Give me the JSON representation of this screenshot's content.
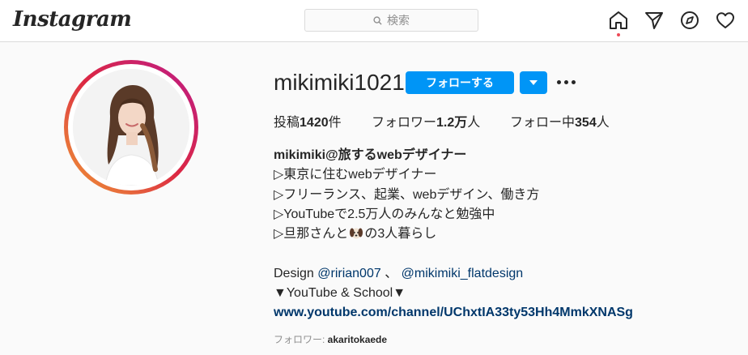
{
  "header": {
    "logo_text": "Instagram",
    "search_placeholder": "検索",
    "icons": [
      "home-icon",
      "direct-message-icon",
      "explore-icon",
      "activity-heart-icon"
    ]
  },
  "profile": {
    "username": "mikimiki1021",
    "follow_label": "フォローする",
    "stats": {
      "posts_label": "投稿",
      "posts_value": "1420",
      "posts_suffix": "件",
      "followers_label": "フォロワー",
      "followers_value": "1.2万",
      "followers_suffix": "人",
      "following_label": "フォロー中",
      "following_value": "354",
      "following_suffix": "人"
    },
    "bio": {
      "name": "mikimiki@旅するwebデザイナー",
      "lines": [
        "▷東京に住むwebデザイナー",
        "▷フリーランス、起業、webデザイン、働き方",
        "▷YouTubeで2.5万人のみんなと勉強中",
        "▷旦那さんと",
        "の3人暮らし"
      ],
      "design_prefix": "Design ",
      "mention_1": "@ririan007",
      "separator": " 、 ",
      "mention_2": "@mikimiki_flatdesign",
      "school_line": "▼YouTube & School▼",
      "link": "www.youtube.com/channel/UChxtIA33ty53Hh4MmkXNASg"
    },
    "followed_by_label": "フォロワー: ",
    "followed_by_user": "akaritokaede"
  },
  "colors": {
    "accent": "#0095f6",
    "link": "#00376b",
    "notification_dot": "#ed4956"
  }
}
